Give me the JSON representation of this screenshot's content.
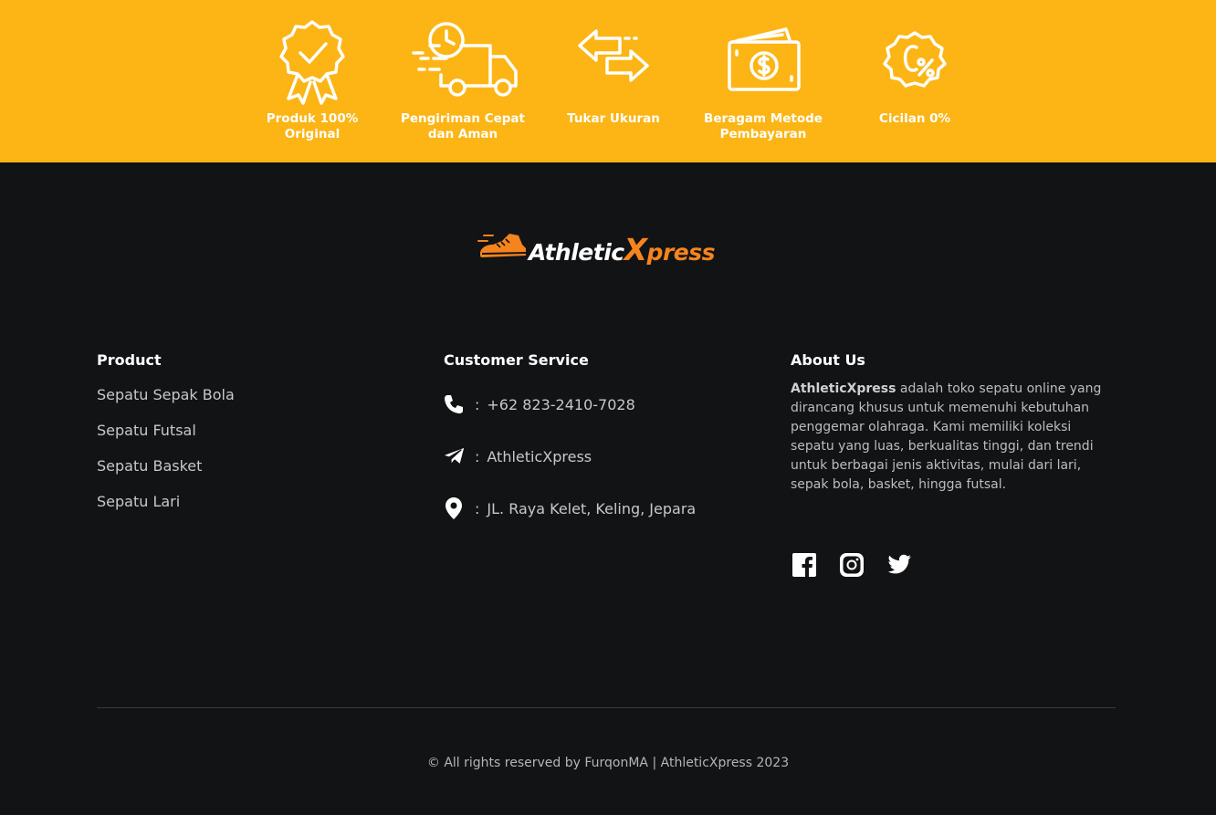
{
  "features": [
    {
      "icon": "award-badge-icon",
      "label": "Produk 100%\nOriginal"
    },
    {
      "icon": "delivery-truck-icon",
      "label": "Pengiriman Cepat\ndan Aman"
    },
    {
      "icon": "exchange-arrows-icon",
      "label": "Tukar Ukuran"
    },
    {
      "icon": "cash-payment-icon",
      "label": "Beragam Metode\nPembayaran"
    },
    {
      "icon": "zero-percent-icon",
      "label": "Cicilan 0%"
    }
  ],
  "logo": {
    "part1": "Athletic",
    "part2": "X",
    "part3": "press",
    "accent": "#F5841F"
  },
  "product": {
    "title": "Product",
    "items": [
      "Sepatu Sepak Bola",
      "Sepatu Futsal",
      "Sepatu Basket",
      "Sepatu Lari"
    ]
  },
  "customer_service": {
    "title": "Customer Service",
    "separator": ":",
    "items": [
      {
        "icon": "phone-icon",
        "value": "+62 823-2410-7028"
      },
      {
        "icon": "telegram-icon",
        "value": "AthleticXpress"
      },
      {
        "icon": "location-pin-icon",
        "value": "JL. Raya Kelet, Keling, Jepara"
      }
    ]
  },
  "about": {
    "title": "About Us",
    "brand": "AthleticXpress",
    "text": " adalah toko sepatu online yang dirancang khusus untuk memenuhi kebutuhan penggemar olahraga. Kami memiliki koleksi sepatu yang luas, berkualitas tinggi, dan trendi untuk berbagai jenis aktivitas, mulai dari lari, sepak bola, basket, hingga futsal."
  },
  "social": [
    "facebook-icon",
    "instagram-icon",
    "twitter-icon"
  ],
  "footer": {
    "copyright": "© All rights reserved by FurqonMA | AthleticXpress 2023"
  },
  "colors": {
    "band": "#FDB515",
    "background": "#121315",
    "accent": "#F5841F"
  }
}
